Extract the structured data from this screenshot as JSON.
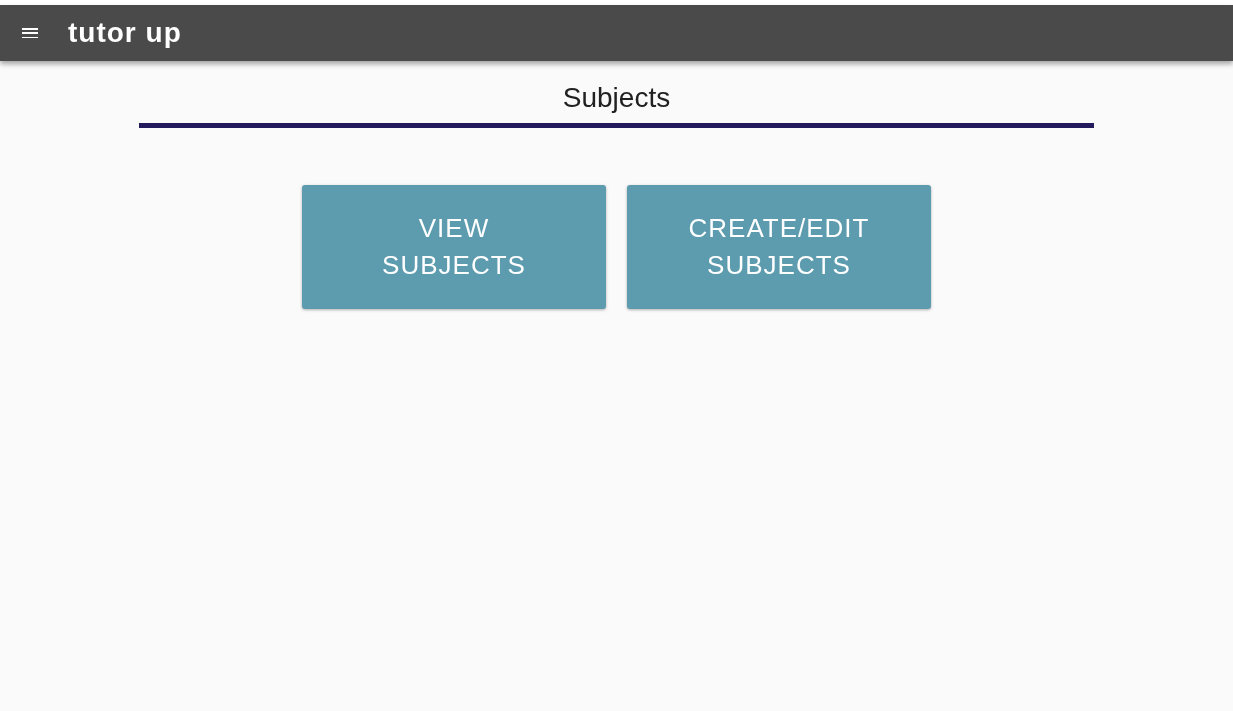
{
  "app_bar": {
    "title": "tutor up"
  },
  "page": {
    "heading": "Subjects"
  },
  "buttons": [
    {
      "label": "VIEW SUBJECTS"
    },
    {
      "label": "CREATE/EDIT SUBJECTS"
    }
  ]
}
